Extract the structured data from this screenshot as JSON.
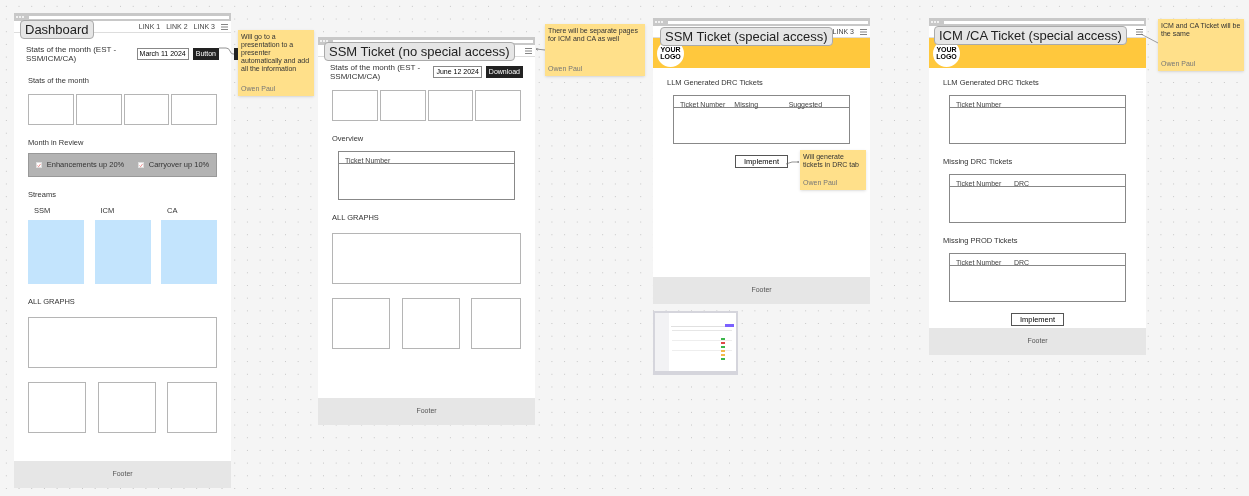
{
  "frames": [
    {
      "tag": "Dashboard",
      "nav_links": [
        "LINK 1",
        "LINK 2",
        "LINK 3"
      ],
      "footer": "Footer",
      "sections": [
        {
          "kind": "header_row",
          "title": "Stats of the month  (EST - SSM/ICM/CA)",
          "date": "March 11 2024",
          "action": "Button"
        },
        {
          "kind": "heading",
          "text": "Stats of the month"
        },
        {
          "kind": "stat_boxes"
        },
        {
          "kind": "heading",
          "text": "Month in Review"
        },
        {
          "kind": "review",
          "items": [
            {
              "label": "Enhancements up 20%",
              "checked": true
            },
            {
              "label": "Carryover up 10%",
              "checked": true
            }
          ]
        },
        {
          "kind": "heading",
          "text": "Streams"
        },
        {
          "kind": "streams",
          "items": [
            "SSM",
            "ICM",
            "CA"
          ]
        },
        {
          "kind": "heading",
          "text": "ALL GRAPHS"
        },
        {
          "kind": "graph_wide"
        },
        {
          "kind": "graph_row"
        }
      ]
    },
    {
      "tag": "SSM Ticket (no special access)",
      "footer": "Footer",
      "sections": [
        {
          "kind": "header_row",
          "title": "Stats of the month  (EST - SSM/ICM/CA)",
          "date": "June 12 2024",
          "action": "Download"
        },
        {
          "kind": "stat_boxes"
        },
        {
          "kind": "heading",
          "text": "Overview"
        },
        {
          "kind": "table",
          "columns": [
            "Ticket Number"
          ]
        },
        {
          "kind": "heading",
          "text": "ALL GRAPHS"
        },
        {
          "kind": "graph_wide"
        },
        {
          "kind": "graph_row"
        }
      ]
    },
    {
      "tag": "SSM Ticket (special access)",
      "nav_links": [
        "LINK 3"
      ],
      "banner": {
        "logo": "YOUR LOGO"
      },
      "footer": "Footer",
      "sections": [
        {
          "kind": "heading",
          "text": "LLM Generated DRC Tickets"
        },
        {
          "kind": "table",
          "columns": [
            "Ticket Number",
            "Missing",
            "Suggested"
          ]
        },
        {
          "kind": "button",
          "label": "Implement"
        }
      ]
    },
    {
      "tag": "ICM /CA Ticket (special access)",
      "banner": {
        "logo": "YOUR LOGO"
      },
      "footer": "Footer",
      "sections": [
        {
          "kind": "heading",
          "text": "LLM Generated DRC Tickets"
        },
        {
          "kind": "table",
          "columns": [
            "Ticket Number"
          ]
        },
        {
          "kind": "heading",
          "text": "Missing DRC Tickets"
        },
        {
          "kind": "table",
          "columns": [
            "Ticket Number",
            "DRC"
          ]
        },
        {
          "kind": "heading",
          "text": "Missing PROD Tickets"
        },
        {
          "kind": "table",
          "columns": [
            "Ticket Number",
            "DRC"
          ]
        },
        {
          "kind": "button",
          "label": "Implement"
        }
      ]
    }
  ],
  "notes": [
    {
      "text": "Will go to a presentation to a presenter automatically and add all the information",
      "author": "Owen Paul"
    },
    {
      "text": "There will be separate pages for ICM and CA as well",
      "author": "Owen Paul"
    },
    {
      "text": "Will generate tickets in DRC tab",
      "author": "Owen Paul"
    },
    {
      "text": "ICM and CA Ticket will be the same",
      "author": "Owen Paul"
    }
  ]
}
